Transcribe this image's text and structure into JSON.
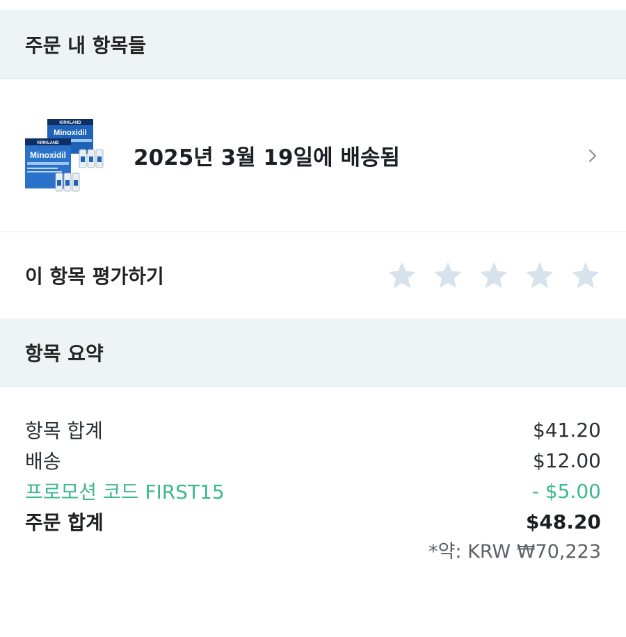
{
  "sections": {
    "items_header": "주문 내 항목들",
    "summary_header": "항목 요약"
  },
  "order_item": {
    "delivery_status": "2025년 3월 19일에 배송됨",
    "product_image_brand": "KIRKLAND",
    "product_image_name": "Minoxidil",
    "icon": "chevron-right-icon"
  },
  "rating": {
    "label": "이 항목 평가하기",
    "max_stars": 5,
    "selected": 0,
    "star_color": "#d6e3ec"
  },
  "summary": {
    "rows": [
      {
        "label": "항목 합계",
        "value": "$41.20"
      },
      {
        "label": "배송",
        "value": "$12.00"
      },
      {
        "label": "프로모션 코드 FIRST15",
        "value": "- $5.00"
      },
      {
        "label": "주문 합계",
        "value": "$48.20"
      }
    ],
    "approx": "*약: KRW ₩70,223"
  },
  "colors": {
    "header_bg": "#eef3f6",
    "promo": "#3cb98c"
  }
}
